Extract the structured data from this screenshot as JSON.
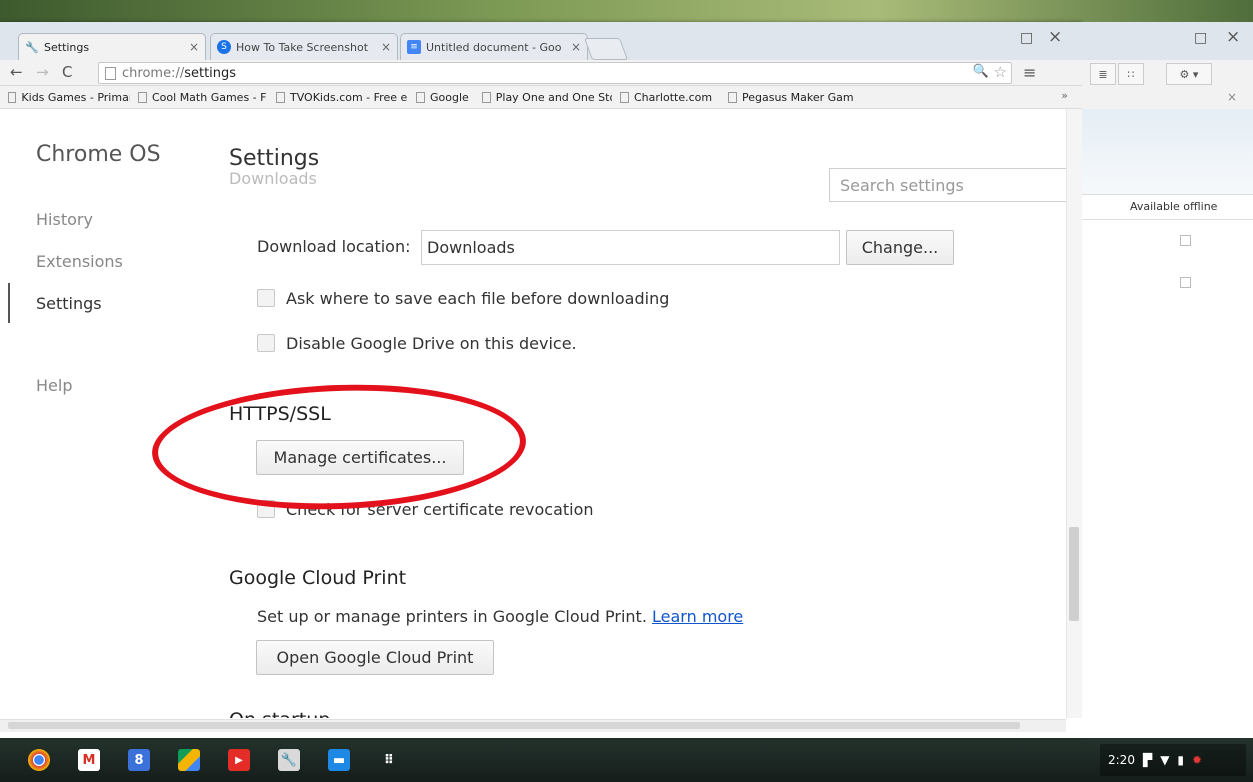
{
  "tabs": [
    {
      "title": "Settings",
      "icon": "wrench-icon"
    },
    {
      "title": "How To Take Screenshot",
      "icon": "site-favicon-icon"
    },
    {
      "title": "Untitled document - Goo",
      "icon": "docs-icon"
    }
  ],
  "window_controls": {
    "maximize": "□",
    "close": "×"
  },
  "omnibox": {
    "scheme": "chrome://",
    "host": "settings"
  },
  "bookmarks": [
    "Kids Games - Primary",
    "Cool Math Games - F",
    "TVOKids.com - Free e",
    "Google",
    "Play One and One Sto",
    "Charlotte.com",
    "Pegasus Maker Gam"
  ],
  "bookmarks_overflow": "»",
  "sidebar": {
    "title": "Chrome OS",
    "items": [
      "History",
      "Extensions",
      "Settings",
      "Help"
    ],
    "selected": "Settings"
  },
  "settings": {
    "title": "Settings",
    "search_placeholder": "Search settings",
    "ghost_section": "Downloads",
    "download_location_label": "Download location:",
    "download_location_value": "Downloads",
    "change_button": "Change...",
    "ask_where_label": "Ask where to save each file before downloading",
    "disable_drive_label": "Disable Google Drive on this device.",
    "https_title": "HTTPS/SSL",
    "manage_certs_button": "Manage certificates...",
    "check_revocation_label": "Check for server certificate revocation",
    "cloud_print_title": "Google Cloud Print",
    "cloud_print_desc": "Set up or manage printers in Google Cloud Print.",
    "learn_more": "Learn more",
    "open_cloud_print_button": "Open Google Cloud Print",
    "startup_title": "On startup"
  },
  "drive_panel": {
    "close": "×",
    "column_header": "Available offline"
  },
  "shelf": {
    "apps": [
      "chrome-icon",
      "gmail-icon",
      "google-plus-icon",
      "drive-icon",
      "youtube-icon",
      "settings-app-icon",
      "files-icon",
      "app-launcher-icon"
    ],
    "time": "2:20"
  },
  "colors": {
    "annotation": "#e3111b",
    "link": "#1155cc"
  }
}
